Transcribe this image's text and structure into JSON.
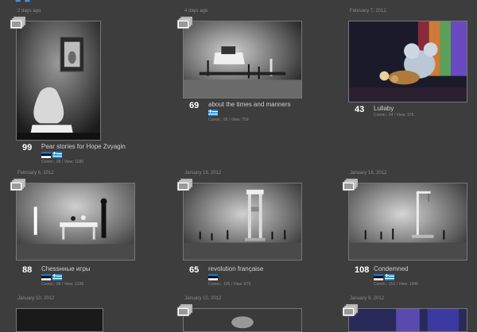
{
  "page": {
    "top_mark": "▘▘"
  },
  "cards": [
    {
      "date": "2 days ago",
      "count": "99",
      "title": "Pear stories for Hope Zvyagin",
      "flags": [
        "estonia",
        "greece"
      ],
      "stats": "Comm.: 99 / View: 1189"
    },
    {
      "date": "4 days ago",
      "count": "69",
      "title": "about the times and manners",
      "flags": [
        "greece"
      ],
      "stats": "Comm.: 95 / View: 759"
    },
    {
      "date": "February 7, 2012",
      "count": "43",
      "title": "Lullaby",
      "flags": [],
      "stats": "Comm.: 54 / View: 376"
    },
    {
      "date": "February 6, 2012",
      "count": "88",
      "title": "Chessнные игры",
      "flags": [
        "estonia",
        "greece"
      ],
      "stats": "Comm.: 68 / View: 1236"
    },
    {
      "date": "January 19, 2012",
      "count": "65",
      "title": "revolution française",
      "flags": [
        "estonia"
      ],
      "stats": "Comm.: 105 / View: 873"
    },
    {
      "date": "January 16, 2012",
      "count": "108",
      "title": "Condemned",
      "flags": [
        "estonia",
        "greece"
      ],
      "stats": "Comm.: 151 / View: 1946"
    },
    {
      "date": "January 10, 2012",
      "count": "",
      "title": "",
      "flags": [],
      "stats": ""
    },
    {
      "date": "January 10, 2012",
      "count": "",
      "title": "",
      "flags": [],
      "stats": ""
    },
    {
      "date": "January 9, 2012",
      "count": "",
      "title": "",
      "flags": [],
      "stats": ""
    }
  ],
  "colors": {
    "background": "#3d3d3d",
    "title_text": "#cfcfcf",
    "count_text": "#ffffff",
    "meta_text": "#8c8c8c",
    "top_mark": "#4a8fd8"
  }
}
